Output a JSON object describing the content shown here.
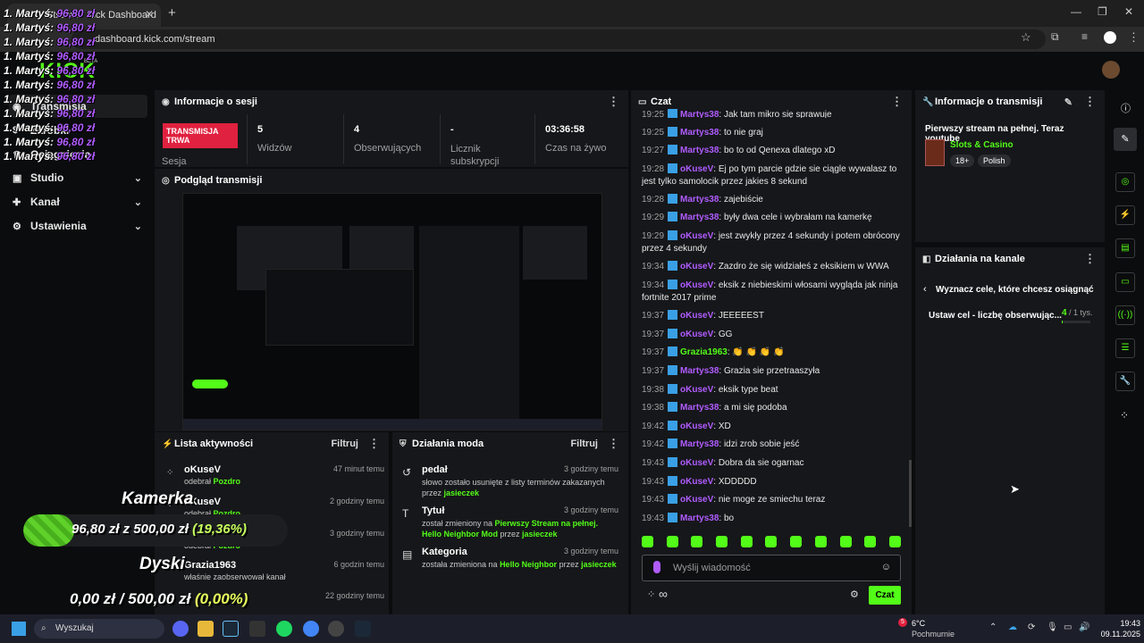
{
  "browser": {
    "tab_title": "Stream - Kick Dashboard",
    "url": "dashboard.kick.com/stream"
  },
  "logo": {
    "text": "KICK",
    "beta": "BETA"
  },
  "overlay_lines": {
    "prefix": "1. Martyś:",
    "amount": "96,80 zł"
  },
  "sidebar": {
    "items": [
      {
        "label": "Transmisja",
        "icon": "broadcast-icon"
      },
      {
        "label": "Zarobki",
        "icon": "dollar-icon"
      },
      {
        "label": "Osiągnięcia",
        "icon": "trophy-icon"
      },
      {
        "label": "Studio",
        "icon": "studio-icon"
      },
      {
        "label": "Kanał",
        "icon": "channel-icon"
      },
      {
        "label": "Ustawienia",
        "icon": "gear-icon"
      }
    ]
  },
  "session": {
    "title": "Informacje o sesji",
    "live_badge": "TRANSMISJA TRWA",
    "session_label": "Sesja",
    "stats": [
      {
        "value": "5",
        "label": "Widzów"
      },
      {
        "value": "4",
        "label": "Obserwujących"
      },
      {
        "value": "-",
        "label": "Licznik subskrypcji"
      },
      {
        "value": "03:36:58",
        "label": "Czas na żywo"
      }
    ]
  },
  "preview": {
    "title": "Podgląd transmisji"
  },
  "activity": {
    "title": "Lista aktywności",
    "filter": "Filtruj",
    "rows": [
      {
        "name": "oKuseV",
        "desc_prefix": "odebrał ",
        "desc_highlight": "Pozdro",
        "time": "47 minut temu"
      },
      {
        "name": "oKuseV",
        "desc_prefix": "odebrał ",
        "desc_highlight": "Pozdro",
        "time": "2 godziny temu"
      },
      {
        "name": "",
        "desc_prefix": "odebrał ",
        "desc_highlight": "Pozdro",
        "time": "3 godziny temu"
      },
      {
        "name": "Grazia1963",
        "desc_prefix": "właśnie zaobserwował kanał",
        "desc_highlight": "",
        "time": "6 godzin temu"
      },
      {
        "name": "",
        "desc_prefix": "",
        "desc_highlight": "",
        "time": "22 godziny temu"
      }
    ]
  },
  "mod": {
    "title": "Działania moda",
    "filter": "Filtruj",
    "rows": [
      {
        "title": "pedał",
        "time": "3 godziny temu",
        "desc_a": "słowo zostało usunięte z listy terminów zakazanych przez ",
        "hl1": "jasieczek",
        "desc_b": "",
        "hl2": ""
      },
      {
        "title": "Tytuł",
        "time": "3 godziny temu",
        "desc_a": "został zmieniony na ",
        "hl1": "Pierwszy Stream na pełnej. Hello Neighbor Mod",
        "desc_b": " przez ",
        "hl2": "jasieczek"
      },
      {
        "title": "Kategoria",
        "time": "3 godziny temu",
        "desc_a": "została zmieniona na ",
        "hl1": "Hello Neighbor",
        "desc_b": " przez ",
        "hl2": "jasieczek"
      }
    ]
  },
  "chat": {
    "title": "Czat",
    "messages": [
      {
        "ts": "19:25",
        "user": "Martys38",
        "cls": "u1",
        "text": "Jak tam mikro się sprawuje"
      },
      {
        "ts": "19:25",
        "user": "Martys38",
        "cls": "u1",
        "text": "to nie graj"
      },
      {
        "ts": "19:27",
        "user": "Martys38",
        "cls": "u1",
        "text": "bo to od Qenexa dlatego xD"
      },
      {
        "ts": "19:28",
        "user": "oKuseV",
        "cls": "u2",
        "text": "Ej po tym parcie gdzie sie ciągle wywalasz to jest tylko samolocik przez jakies 8 sekund"
      },
      {
        "ts": "19:28",
        "user": "Martys38",
        "cls": "u1",
        "text": "zajebiście"
      },
      {
        "ts": "19:29",
        "user": "Martys38",
        "cls": "u1",
        "text": "były dwa cele i wybrałam na kamerkę"
      },
      {
        "ts": "19:29",
        "user": "oKuseV",
        "cls": "u2",
        "text": "jest zwykły przez 4 sekundy i potem obrócony przez 4 sekundy"
      },
      {
        "ts": "19:34",
        "user": "oKuseV",
        "cls": "u2",
        "text": "Zazdro że się widziałeś z eksikiem w WWA"
      },
      {
        "ts": "19:34",
        "user": "oKuseV",
        "cls": "u2",
        "text": "eksik z niebieskimi włosami wygląda jak ninja fortnite 2017 prime"
      },
      {
        "ts": "19:37",
        "user": "oKuseV",
        "cls": "u2",
        "text": "JEEEEEST"
      },
      {
        "ts": "19:37",
        "user": "oKuseV",
        "cls": "u2",
        "text": "GG"
      },
      {
        "ts": "19:37",
        "user": "Grazia1963",
        "cls": "u3",
        "text": "👏 👏 👏 👏"
      },
      {
        "ts": "19:37",
        "user": "Martys38",
        "cls": "u1",
        "text": "Grazia sie przetraaszyła"
      },
      {
        "ts": "19:38",
        "user": "oKuseV",
        "cls": "u2",
        "text": "eksik type beat"
      },
      {
        "ts": "19:38",
        "user": "Martys38",
        "cls": "u1",
        "text": "a mi się podoba"
      },
      {
        "ts": "19:42",
        "user": "oKuseV",
        "cls": "u2",
        "text": "XD"
      },
      {
        "ts": "19:42",
        "user": "Martys38",
        "cls": "u1",
        "text": "idzi zrob sobie jeść"
      },
      {
        "ts": "19:43",
        "user": "oKuseV",
        "cls": "u2",
        "text": "Dobra da sie ogarnac"
      },
      {
        "ts": "19:43",
        "user": "oKuseV",
        "cls": "u2",
        "text": "XDDDDD"
      },
      {
        "ts": "19:43",
        "user": "oKuseV",
        "cls": "u2",
        "text": "nie moge ze smiechu teraz"
      },
      {
        "ts": "19:43",
        "user": "Martys38",
        "cls": "u1",
        "text": "bo"
      }
    ],
    "input_placeholder": "Wyślij wiadomość",
    "send_label": "Czat",
    "infinity": "∞"
  },
  "stream_info": {
    "title": "Informacje o transmisji",
    "stream_title": "Pierwszy stream na pełnej. Teraz youtube",
    "category": "Slots & Casino",
    "tags": [
      "18+",
      "Polish"
    ]
  },
  "channel_actions": {
    "title": "Działania na kanale",
    "goal_heading": "Wyznacz cele, które chcesz osiągnąć",
    "goal_label": "Ustaw cel - liczbę obserwując...",
    "goal_current": "4",
    "goal_target": "/ 1 tys.",
    "goal_progress": 0.004
  },
  "overlay_widget": {
    "camera_title": "Kamerka",
    "camera_amount": "96,80 zł",
    "camera_sep": "z",
    "camera_target": "500,00 zł",
    "camera_pct": "(19,36%)",
    "camera_progress": 0.1936,
    "disks_title": "Dyski",
    "disks_amount": "0,00 zł",
    "disks_sep": "/",
    "disks_target": "500,00 zł",
    "disks_pct": "(0,00%)"
  },
  "taskbar": {
    "search": "Wyszukaj",
    "weather_temp": "6°C",
    "weather_desc": "Pochmurnie",
    "time": "19:43",
    "date": "09.11.2025",
    "notif_count": "5"
  }
}
